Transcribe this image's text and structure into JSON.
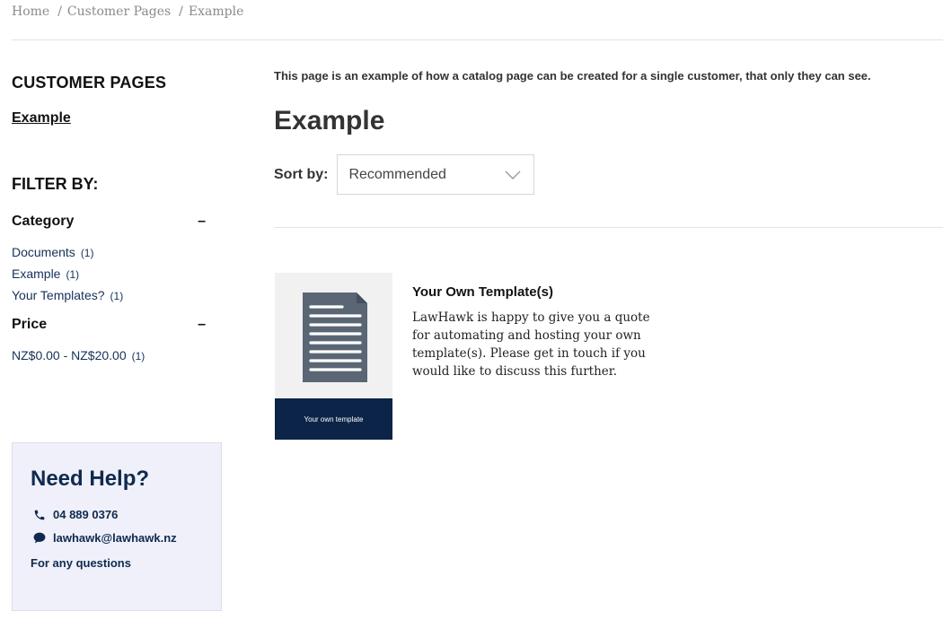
{
  "breadcrumb": {
    "items": [
      "Home",
      "Customer Pages",
      "Example"
    ]
  },
  "sidebar": {
    "heading": "CUSTOMER PAGES",
    "link": "Example",
    "filter_heading": "FILTER BY:",
    "facets": [
      {
        "title": "Category",
        "toggle": "–",
        "items": [
          {
            "label": "Documents",
            "count": "(1)"
          },
          {
            "label": "Example",
            "count": "(1)"
          },
          {
            "label": "Your Templates?",
            "count": "(1)"
          }
        ]
      },
      {
        "title": "Price",
        "toggle": "–",
        "items": [
          {
            "label": "NZ$0.00 - NZ$20.00",
            "count": "(1)"
          }
        ]
      }
    ]
  },
  "help": {
    "title": "Need Help?",
    "phone": "04 889 0376",
    "email": "lawhawk@lawhawk.nz",
    "note": "For any questions",
    "phone_icon": "phone-icon",
    "email_icon": "chat-bubble-icon"
  },
  "main": {
    "intro": "This page is an example of how a catalog page can be created for a single customer, that only they can see.",
    "title": "Example",
    "sort_label": "Sort by:",
    "sort_value": "Recommended"
  },
  "product": {
    "name": "Your Own Template(s)",
    "description": "LawHawk is happy to give you a quote for automating and hosting your own template(s). Please get in touch if you would like to discuss this further.",
    "thumb_caption": "Your own template"
  },
  "colors": {
    "navy": "#0b2447",
    "link": "#16315a",
    "help_bg": "#eff0f9",
    "doc_icon": "#5b6675"
  }
}
